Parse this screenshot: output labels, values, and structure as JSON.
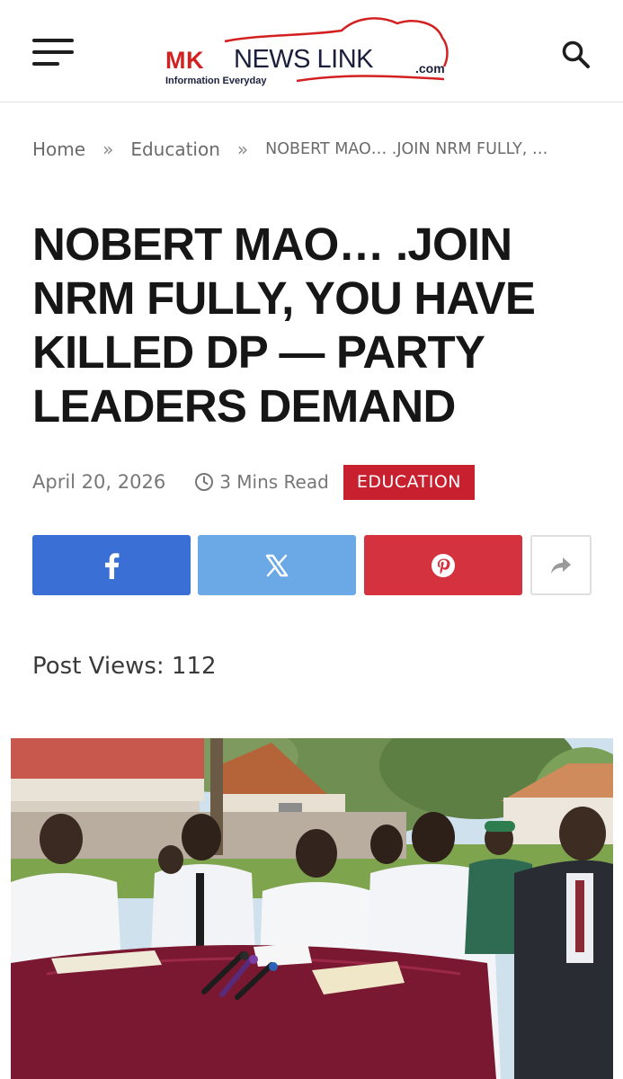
{
  "header": {
    "menu_icon": "hamburger-menu-icon",
    "search_icon": "search-icon",
    "logo": {
      "brand_prefix": "MK",
      "brand_main": "NEWS LINK",
      "brand_suffix": ".com",
      "tagline": "Information Everyday"
    }
  },
  "breadcrumb": {
    "home": "Home",
    "separator": "»",
    "category": "Education",
    "current": "NOBERT MAO… .JOIN NRM FULLY, …"
  },
  "article": {
    "title": "NOBERT MAO… .JOIN NRM FULLY, YOU HAVE KILLED DP — PARTY LEADERS DEMAND",
    "date": "April 20, 2026",
    "read_time": "3 Mins Read",
    "category_badge": "EDUCATION",
    "post_views": "Post Views: 112"
  },
  "share": {
    "facebook_icon": "facebook-icon",
    "x_icon": "x-twitter-icon",
    "pinterest_icon": "pinterest-icon",
    "more_icon": "share-arrow-icon"
  },
  "colors": {
    "brand_red": "#d32020",
    "category_red": "#c8202f",
    "facebook_blue": "#3a6fd6",
    "x_blue": "#6aa9e5",
    "pinterest_red": "#d53240"
  }
}
